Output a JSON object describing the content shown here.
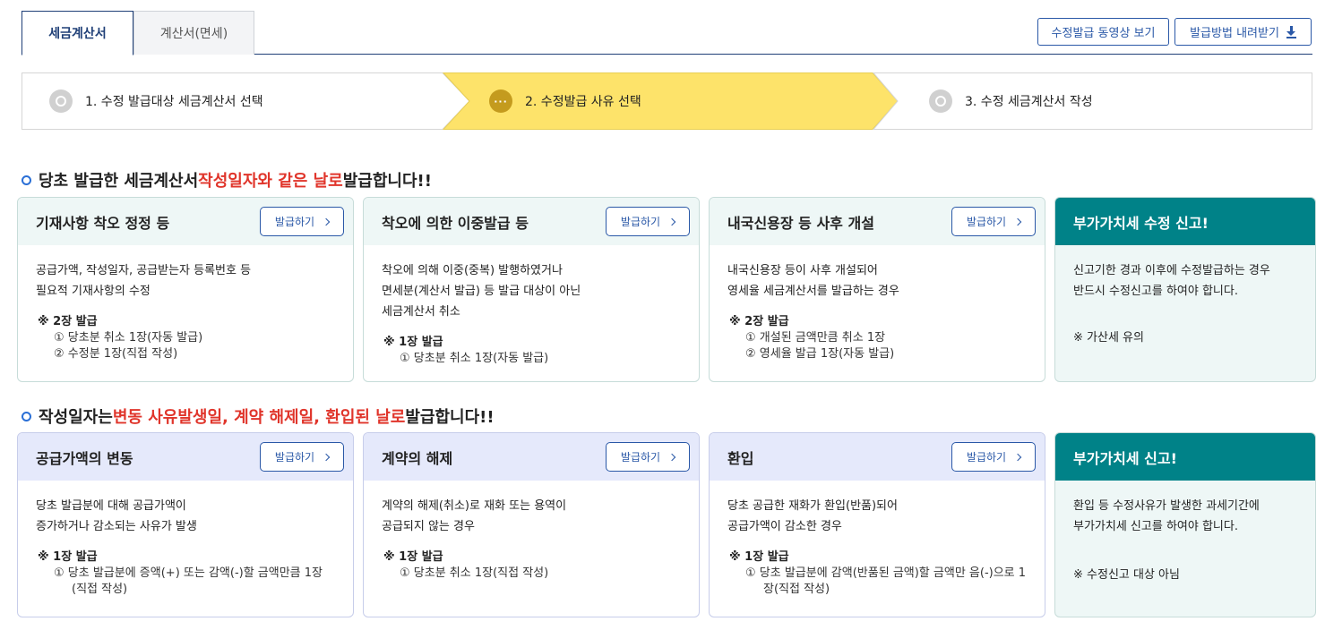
{
  "tabs": [
    {
      "label": "세금계산서",
      "active": true
    },
    {
      "label": "계산서(면세)",
      "active": false
    }
  ],
  "top_buttons": {
    "video": "수정발급 동영상 보기",
    "download": "발급방법 내려받기"
  },
  "steps": [
    {
      "label": "1. 수정 발급대상 세금계산서 선택",
      "state": "done"
    },
    {
      "label": "2. 수정발급 사유 선택",
      "state": "current",
      "icon": "···"
    },
    {
      "label": "3. 수정 세금계산서 작성",
      "state": "todo"
    }
  ],
  "section1": {
    "title_pre": "당초 발급한 세금계산서 ",
    "title_red": "작성일자와 같은 날로",
    "title_post": " 발급합니다!!",
    "cards": [
      {
        "title": "기재사항 착오 정정 등",
        "button": "발급하기",
        "desc": [
          "공급가액, 작성일자, 공급받는자 등록번호 등",
          "필요적 기재사항의 수정"
        ],
        "note_head": "※ 2장 발급",
        "note_items": [
          "① 당초분 취소 1장(자동 발급)",
          "② 수정분 1장(직접 작성)"
        ]
      },
      {
        "title": "착오에 의한 이중발급 등",
        "button": "발급하기",
        "desc": [
          "착오에 의해 이중(중복) 발행하였거나",
          "면세분(계산서 발급) 등 발급 대상이 아닌",
          "세금계산서 취소"
        ],
        "note_head": "※ 1장 발급",
        "note_items": [
          "① 당초분 취소 1장(자동 발급)"
        ]
      },
      {
        "title": "내국신용장 등 사후 개설",
        "button": "발급하기",
        "desc": [
          "내국신용장 등이 사후 개설되어",
          "영세율 세금계산서를 발급하는 경우"
        ],
        "note_head": "※ 2장 발급",
        "note_items": [
          "① 개설된 금액만큼 취소 1장",
          "② 영세율 발급 1장(자동 발급)"
        ]
      },
      {
        "title": "부가가치세 수정 신고!",
        "desc": [
          "신고기한 경과 이후에 수정발급하는 경우",
          "반드시 수정신고를 하여야 합니다."
        ],
        "note": "※ 가산세 유의"
      }
    ]
  },
  "section2": {
    "title_pre": "작성일자는 ",
    "title_red": "변동 사유발생일, 계약 해제일, 환입된 날로",
    "title_post": " 발급합니다!!",
    "cards": [
      {
        "title": "공급가액의 변동",
        "button": "발급하기",
        "desc": [
          "당초 발급분에 대해 공급가액이",
          "증가하거나 감소되는 사유가 발생"
        ],
        "note_head": "※ 1장 발급",
        "note_items": [
          "① 당초 발급분에 증액(+) 또는 감액(-)할 금액만큼 1장(직접 작성)"
        ]
      },
      {
        "title": "계약의 해제",
        "button": "발급하기",
        "desc": [
          "계약의 해제(취소)로 재화 또는 용역이",
          "공급되지 않는 경우"
        ],
        "note_head": "※ 1장 발급",
        "note_items": [
          "① 당초분 취소 1장(직접 작성)"
        ]
      },
      {
        "title": "환입",
        "button": "발급하기",
        "desc": [
          "당초 공급한 재화가 환입(반품)되어",
          "공급가액이 감소한 경우"
        ],
        "note_head": "※ 1장 발급",
        "note_items": [
          "① 당초 발급분에 감액(반품된 금액)할 금액만 음(-)으로 1장(직접 작성)"
        ]
      },
      {
        "title": "부가가치세 신고!",
        "desc": [
          "환입 등 수정사유가 발생한 과세기간에",
          "부가가치세 신고를 하여야 합니다."
        ],
        "note": "※ 수정신고 대상 아님"
      }
    ]
  },
  "colors": {
    "navy": "#1f3f77",
    "blue_button": "#2a58a7",
    "step_active": "#fde36a",
    "red_highlight": "#e0352b",
    "teal": "#008288"
  }
}
